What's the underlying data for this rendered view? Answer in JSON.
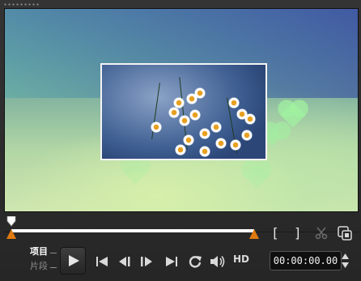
{
  "modes": {
    "project": "项目",
    "clip": "片段"
  },
  "transport": {
    "mark_in": "[",
    "mark_out": "]",
    "hd_label": "HD",
    "timecode": "00:00:00.00"
  },
  "colors": {
    "accent_orange": "#e07a10",
    "scrubber_fill": "#ffffff"
  }
}
